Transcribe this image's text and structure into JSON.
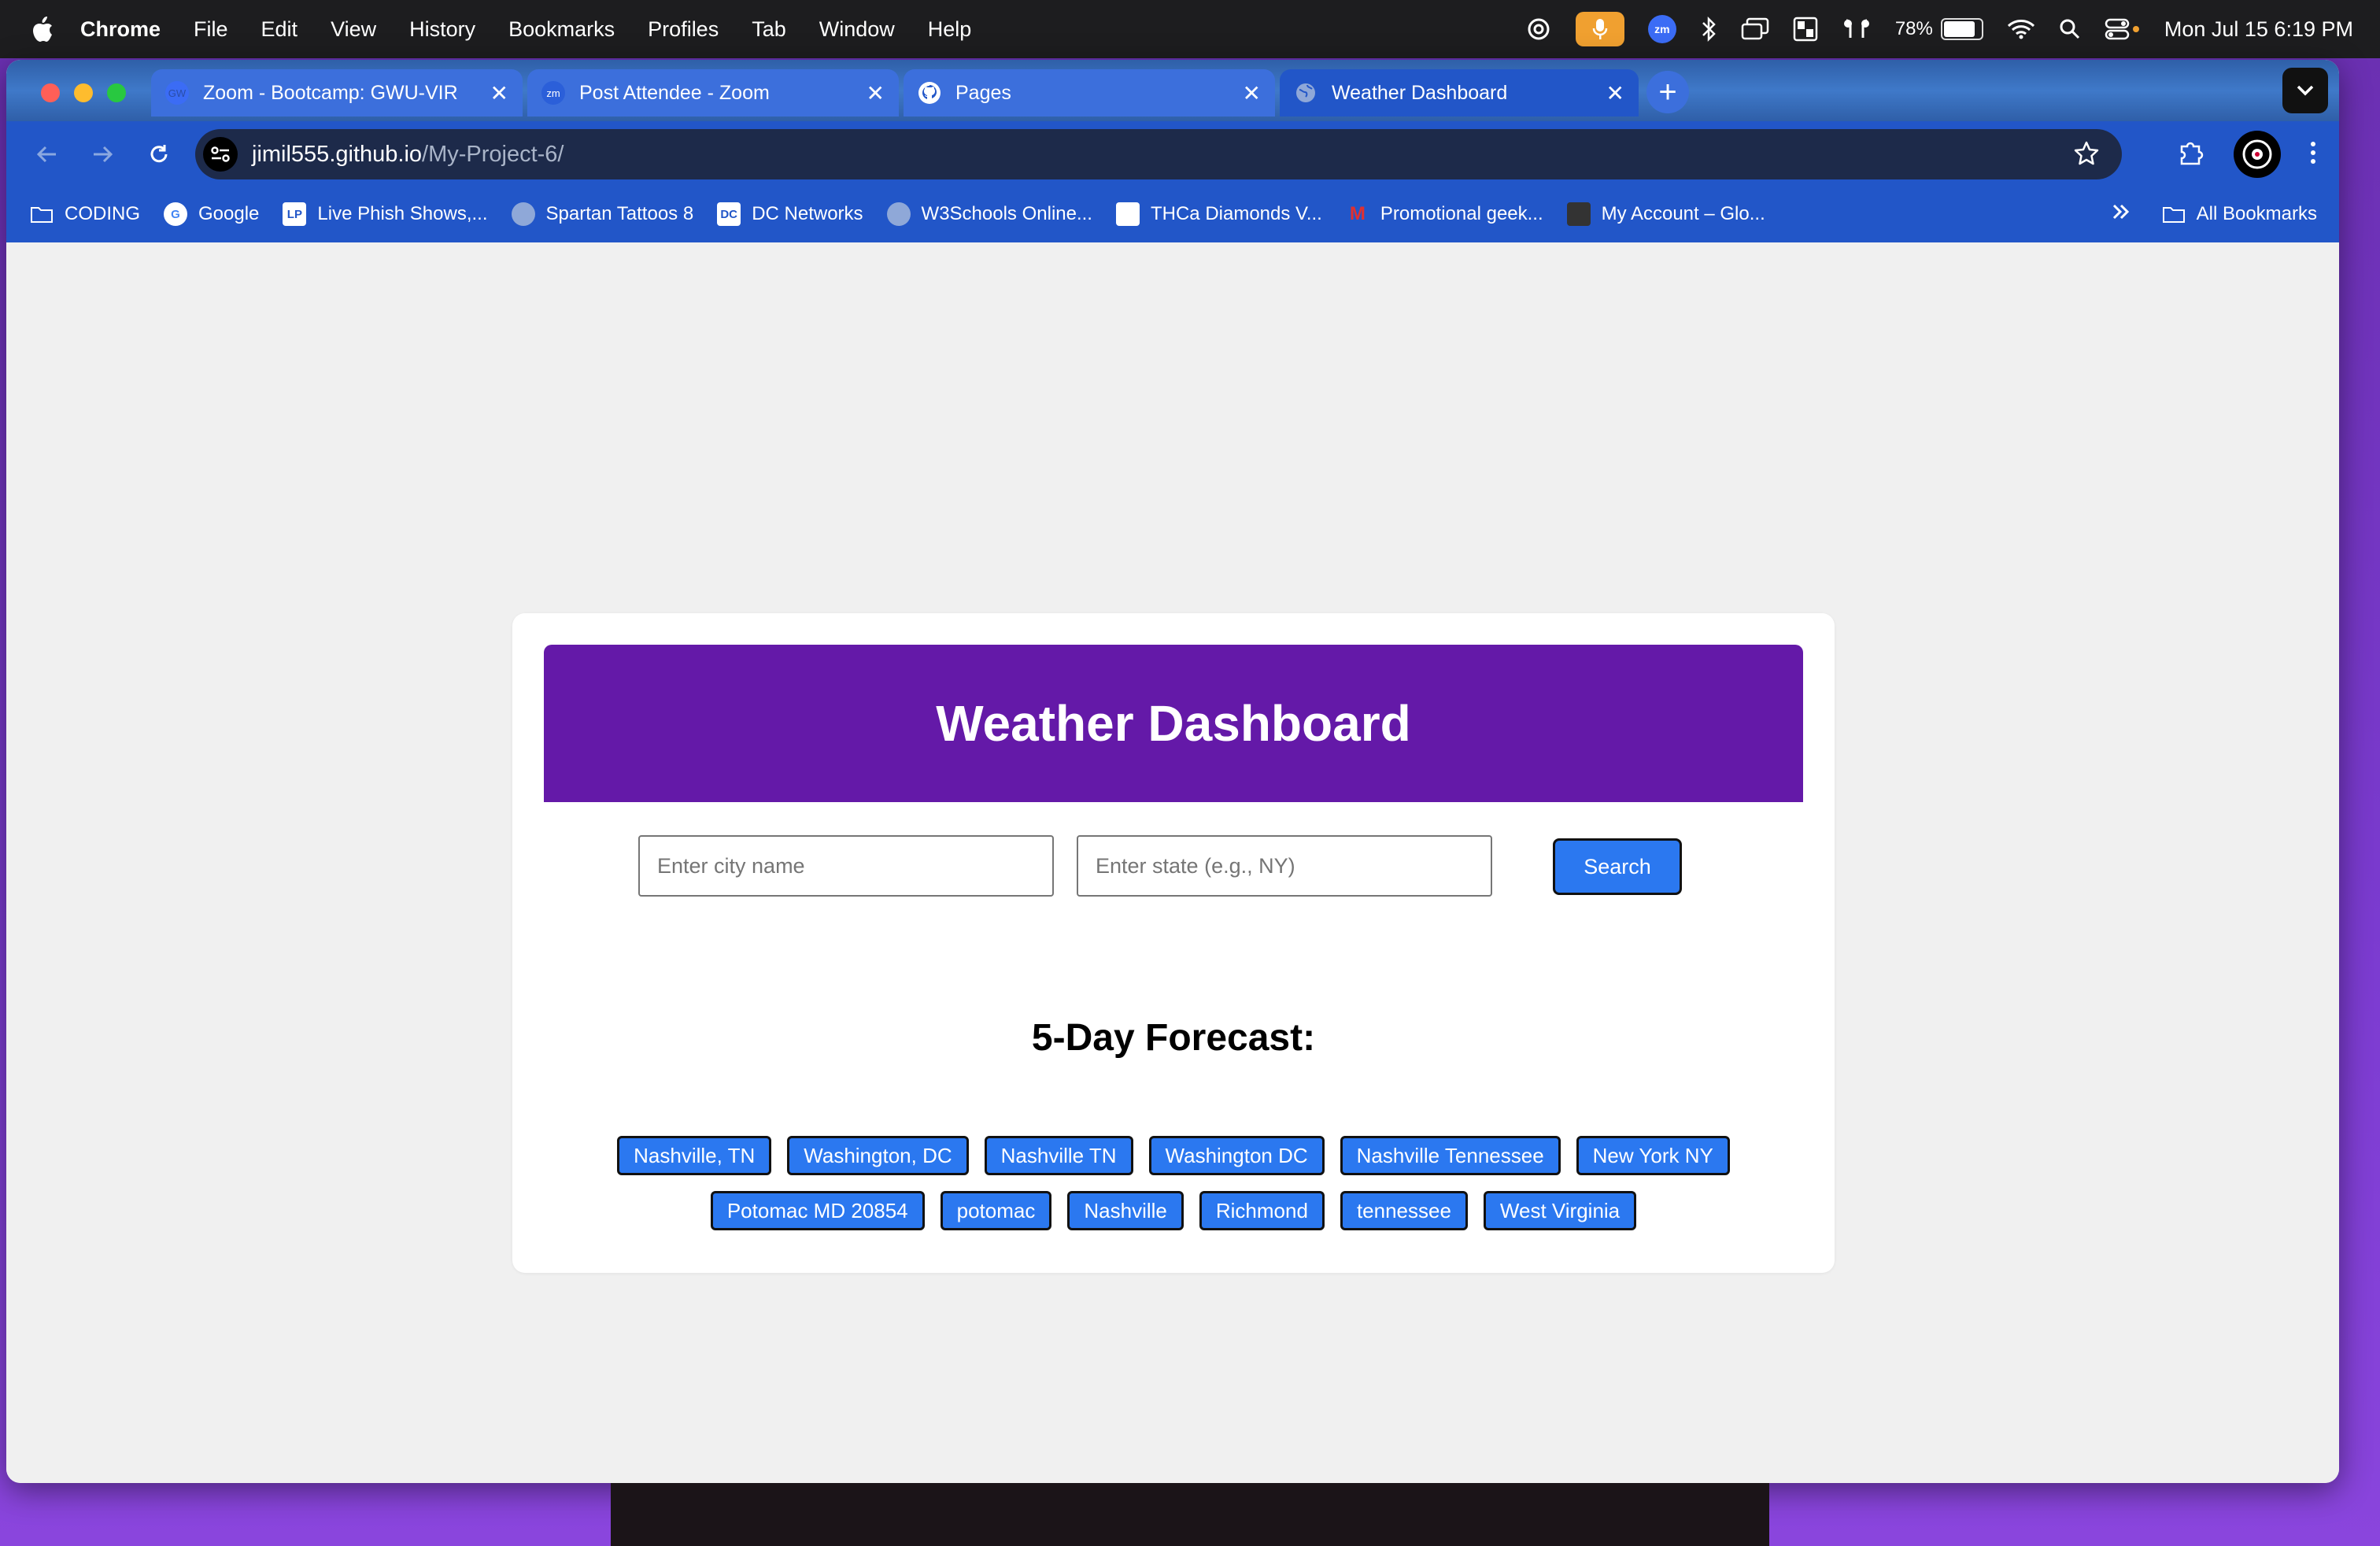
{
  "menubar": {
    "app": "Chrome",
    "items": [
      "File",
      "Edit",
      "View",
      "History",
      "Bookmarks",
      "Profiles",
      "Tab",
      "Window",
      "Help"
    ],
    "battery": "78%",
    "clock": "Mon Jul 15  6:19 PM"
  },
  "tabs": [
    {
      "title": "Zoom - Bootcamp: GWU-VIR",
      "favicon": "GW"
    },
    {
      "title": "Post Attendee - Zoom",
      "favicon": "zm"
    },
    {
      "title": "Pages",
      "favicon": "github"
    },
    {
      "title": "Weather Dashboard",
      "favicon": "globe"
    }
  ],
  "address": {
    "host": "jimil555.github.io",
    "path": "/My-Project-6/"
  },
  "bookmarks": [
    {
      "label": "CODING"
    },
    {
      "label": "Google"
    },
    {
      "label": "Live Phish Shows,..."
    },
    {
      "label": "Spartan Tattoos 8"
    },
    {
      "label": "DC Networks"
    },
    {
      "label": "W3Schools Online..."
    },
    {
      "label": "THCa Diamonds V..."
    },
    {
      "label": "Promotional geek..."
    },
    {
      "label": "My Account – Glo..."
    }
  ],
  "all_bookmarks": "All Bookmarks",
  "dashboard": {
    "title": "Weather Dashboard",
    "city_placeholder": "Enter city name",
    "state_placeholder": "Enter state (e.g., NY)",
    "search_label": "Search",
    "forecast_title": "5-Day Forecast:",
    "history": [
      [
        "Nashville, TN",
        "Washington, DC",
        "Nashville TN",
        "Washington DC",
        "Nashville Tennessee",
        "New York NY"
      ],
      [
        "Potomac MD 20854",
        "potomac",
        "Nashville",
        "Richmond",
        "tennessee",
        "West Virginia"
      ]
    ]
  },
  "colors": {
    "header": "#6419a8",
    "button": "#2b78f0",
    "tab_active": "#2256c8"
  }
}
